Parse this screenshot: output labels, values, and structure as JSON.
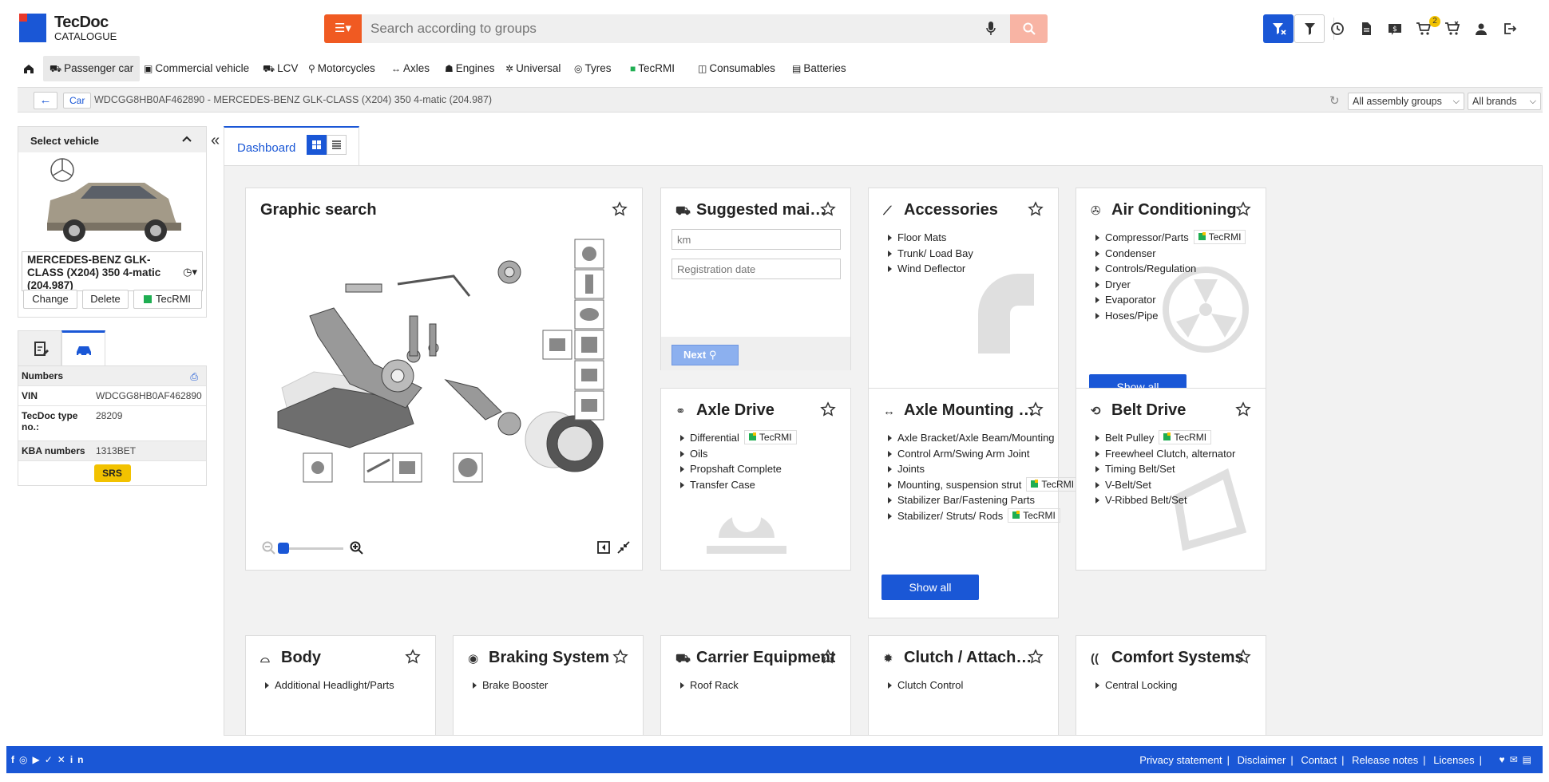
{
  "logo": {
    "title": "TecDoc",
    "subtitle": "CATALOGUE"
  },
  "search": {
    "placeholder": "Search according to groups"
  },
  "cart_count": "2",
  "nav": [
    {
      "label": "Passenger car",
      "icon": "car-icon",
      "active": true
    },
    {
      "label": "Commercial vehicle",
      "icon": "bus-icon"
    },
    {
      "label": "LCV",
      "icon": "truck-icon"
    },
    {
      "label": "Motorcycles",
      "icon": "motorcycle-icon"
    },
    {
      "label": "Axles",
      "icon": "axle-icon"
    },
    {
      "label": "Engines",
      "icon": "engine-icon"
    },
    {
      "label": "Universal",
      "icon": "universal-icon"
    },
    {
      "label": "Tyres",
      "icon": "tyre-icon"
    },
    {
      "label": "TecRMI",
      "icon": "tecrmi-icon"
    },
    {
      "label": "Consumables",
      "icon": "consumables-icon"
    },
    {
      "label": "Batteries",
      "icon": "battery-icon"
    }
  ],
  "breadcrumb": {
    "type": "Car",
    "vehicle": "WDCGG8HB0AF462890 - MERCEDES-BENZ GLK-CLASS (X204) 350 4-matic (204.987)",
    "groups_select": "All assembly groups",
    "brands_select": "All brands"
  },
  "sidebar": {
    "header": "Select vehicle",
    "vehicle_name": "MERCEDES-BENZ GLK-CLASS (X204) 350 4-matic (204.987)",
    "buttons": {
      "change": "Change",
      "delete": "Delete",
      "tecrmi": "TecRMI"
    },
    "numbers_label": "Numbers",
    "rows": [
      {
        "key": "VIN",
        "value": "WDCGG8HB0AF462890"
      },
      {
        "key": "TecDoc type no.:",
        "value": "28209"
      },
      {
        "key": "KBA numbers",
        "value": "1313BET"
      }
    ],
    "srs": "SRS"
  },
  "main": {
    "tab": "Dashboard"
  },
  "cards": {
    "graphic": {
      "title": "Graphic search"
    },
    "maintenance": {
      "title": "Suggested maintena...",
      "km_placeholder": "km",
      "date_placeholder": "Registration date",
      "next": "Next"
    },
    "accessories": {
      "title": "Accessories",
      "items": [
        "Floor Mats",
        "Trunk/ Load Bay",
        "Wind Deflector"
      ]
    },
    "aircon": {
      "title": "Air Conditioning",
      "items": [
        {
          "t": "Compressor/Parts",
          "r": "TecRMI"
        },
        {
          "t": "Condenser"
        },
        {
          "t": "Controls/Regulation"
        },
        {
          "t": "Dryer"
        },
        {
          "t": "Evaporator"
        },
        {
          "t": "Hoses/Pipe"
        }
      ],
      "show_all": "Show all"
    },
    "axledrive": {
      "title": "Axle Drive",
      "items": [
        {
          "t": "Differential",
          "r": "TecRMI"
        },
        {
          "t": "Oils"
        },
        {
          "t": "Propshaft Complete"
        },
        {
          "t": "Transfer Case"
        }
      ]
    },
    "axlemount": {
      "title": "Axle Mounting / Stee...",
      "items": [
        {
          "t": "Axle Bracket/Axle Beam/Mounting"
        },
        {
          "t": "Control Arm/Swing Arm Joint"
        },
        {
          "t": "Joints"
        },
        {
          "t": "Mounting, suspension strut",
          "r": "TecRMI"
        },
        {
          "t": "Stabilizer Bar/Fastening Parts"
        },
        {
          "t": "Stabilizer/ Struts/ Rods",
          "r": "TecRMI"
        }
      ],
      "show_all": "Show all"
    },
    "belt": {
      "title": "Belt Drive",
      "items": [
        {
          "t": "Belt Pulley",
          "r": "TecRMI"
        },
        {
          "t": "Freewheel Clutch, alternator"
        },
        {
          "t": "Timing Belt/Set"
        },
        {
          "t": "V-Belt/Set"
        },
        {
          "t": "V-Ribbed Belt/Set"
        }
      ]
    },
    "body": {
      "title": "Body",
      "items": [
        "Additional Headlight/Parts"
      ]
    },
    "braking": {
      "title": "Braking System",
      "items": [
        "Brake Booster"
      ]
    },
    "carrier": {
      "title": "Carrier Equipment",
      "items": [
        "Roof Rack"
      ]
    },
    "clutch": {
      "title": "Clutch / Attachment ...",
      "items": [
        "Clutch Control"
      ]
    },
    "comfort": {
      "title": "Comfort Systems",
      "items": [
        "Central Locking"
      ]
    }
  },
  "footer": {
    "links": [
      "Privacy statement",
      "Disclaimer",
      "Contact",
      "Release notes",
      "Licenses"
    ]
  },
  "colors": {
    "brand": "#1a57d6",
    "accent": "#f05a22",
    "badge": "#f2c200"
  }
}
